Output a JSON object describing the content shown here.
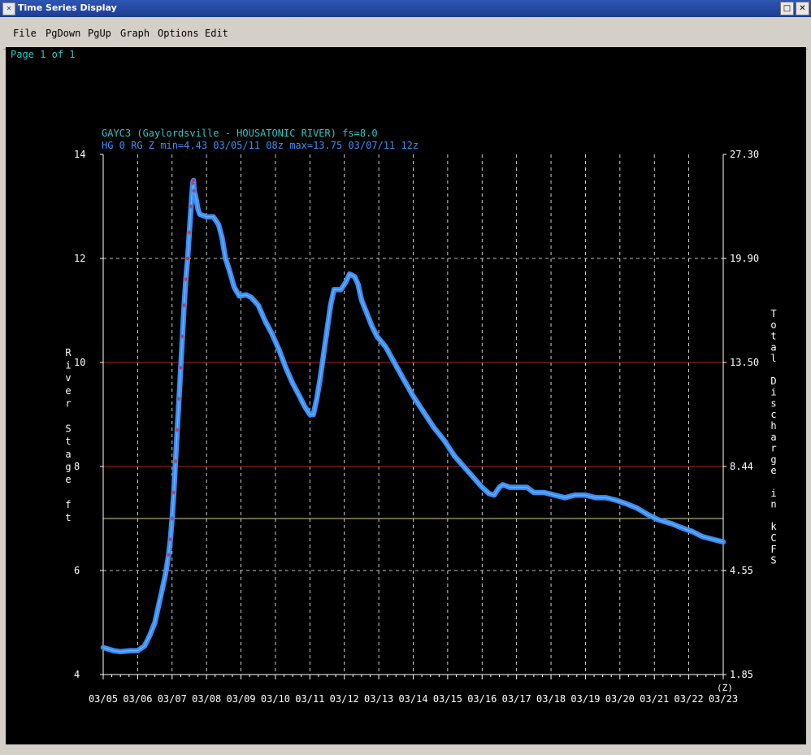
{
  "window": {
    "title": "Time Series Display"
  },
  "menu": [
    "File",
    "PgDown",
    "PgUp",
    "Graph",
    "Options",
    "Edit"
  ],
  "page_label": "Page 1 of 1",
  "header": {
    "line1": "GAYC3 (Gaylordsville - HOUSATONIC RIVER) fs=8.0",
    "line2": "HG 0 RG Z min=4.43 03/05/11 08z max=13.75 03/07/11 12z"
  },
  "colors": {
    "trace": "#3b8ff5",
    "observed": "#d6304b",
    "minor_flood": "#b42020",
    "action": "#d8d870",
    "text": "#2ec6c6",
    "axis": "#ffffff"
  },
  "chart_data": {
    "type": "line",
    "title": "GAYC3 (Gaylordsville - HOUSATONIC RIVER) fs=8.0",
    "ylabel": "River Stage ft",
    "y2label": "Total Discharge in kCFS",
    "xunit": "(Z)",
    "ylim": [
      4,
      14
    ],
    "yticks": [
      "14",
      "12",
      "10",
      "8",
      "6",
      "4"
    ],
    "y2ticks": [
      "27.30",
      "19.90",
      "13.50",
      "8.44",
      "4.55",
      "1.85"
    ],
    "xlim": [
      0,
      18
    ],
    "xticks": [
      "03/05",
      "03/06",
      "03/07",
      "03/08",
      "03/09",
      "03/10",
      "03/11",
      "03/12",
      "03/13",
      "03/14",
      "03/15",
      "03/16",
      "03/17",
      "03/18",
      "03/19",
      "03/20",
      "03/21",
      "03/22",
      "03/23"
    ],
    "threshold_lines": [
      {
        "y": 10,
        "color": "#b42020"
      },
      {
        "y": 8,
        "color": "#b42020"
      },
      {
        "y": 7,
        "color": "#d8d870"
      }
    ],
    "series": [
      {
        "points": [
          [
            0.0,
            4.52
          ],
          [
            0.3,
            4.46
          ],
          [
            0.5,
            4.44
          ],
          [
            0.8,
            4.46
          ],
          [
            1.0,
            4.46
          ],
          [
            1.2,
            4.55
          ],
          [
            1.35,
            4.75
          ],
          [
            1.5,
            5.0
          ],
          [
            1.6,
            5.3
          ],
          [
            1.7,
            5.6
          ],
          [
            1.8,
            5.9
          ],
          [
            1.9,
            6.3
          ],
          [
            1.95,
            6.6
          ],
          [
            2.0,
            7.0
          ],
          [
            2.05,
            7.5
          ],
          [
            2.1,
            8.1
          ],
          [
            2.15,
            8.7
          ],
          [
            2.2,
            9.3
          ],
          [
            2.25,
            9.9
          ],
          [
            2.3,
            10.5
          ],
          [
            2.35,
            11.1
          ],
          [
            2.4,
            11.6
          ],
          [
            2.45,
            12.0
          ],
          [
            2.5,
            12.5
          ],
          [
            2.55,
            13.0
          ],
          [
            2.6,
            13.45
          ],
          [
            2.62,
            13.5
          ],
          [
            2.64,
            13.3
          ],
          [
            2.68,
            13.2
          ],
          [
            2.75,
            12.95
          ],
          [
            2.8,
            12.85
          ],
          [
            3.0,
            12.8
          ],
          [
            3.2,
            12.8
          ],
          [
            3.35,
            12.65
          ],
          [
            3.45,
            12.4
          ],
          [
            3.55,
            12.0
          ],
          [
            3.65,
            11.8
          ],
          [
            3.8,
            11.45
          ],
          [
            3.95,
            11.28
          ],
          [
            4.15,
            11.3
          ],
          [
            4.3,
            11.25
          ],
          [
            4.5,
            11.1
          ],
          [
            4.7,
            10.8
          ],
          [
            4.9,
            10.55
          ],
          [
            5.1,
            10.25
          ],
          [
            5.3,
            9.9
          ],
          [
            5.5,
            9.6
          ],
          [
            5.7,
            9.35
          ],
          [
            5.85,
            9.15
          ],
          [
            6.0,
            9.0
          ],
          [
            6.1,
            9.0
          ],
          [
            6.2,
            9.3
          ],
          [
            6.3,
            9.7
          ],
          [
            6.45,
            10.4
          ],
          [
            6.6,
            11.1
          ],
          [
            6.7,
            11.4
          ],
          [
            6.9,
            11.4
          ],
          [
            7.05,
            11.55
          ],
          [
            7.15,
            11.7
          ],
          [
            7.3,
            11.65
          ],
          [
            7.4,
            11.5
          ],
          [
            7.5,
            11.2
          ],
          [
            7.65,
            10.95
          ],
          [
            7.8,
            10.7
          ],
          [
            7.95,
            10.5
          ],
          [
            8.2,
            10.3
          ],
          [
            8.45,
            10.0
          ],
          [
            8.7,
            9.7
          ],
          [
            9.0,
            9.35
          ],
          [
            9.3,
            9.05
          ],
          [
            9.6,
            8.75
          ],
          [
            9.9,
            8.5
          ],
          [
            10.0,
            8.4
          ],
          [
            10.2,
            8.2
          ],
          [
            10.4,
            8.05
          ],
          [
            10.6,
            7.9
          ],
          [
            10.8,
            7.75
          ],
          [
            11.0,
            7.6
          ],
          [
            11.2,
            7.48
          ],
          [
            11.35,
            7.45
          ],
          [
            11.5,
            7.6
          ],
          [
            11.6,
            7.65
          ],
          [
            11.8,
            7.6
          ],
          [
            12.0,
            7.6
          ],
          [
            12.3,
            7.6
          ],
          [
            12.5,
            7.5
          ],
          [
            12.8,
            7.5
          ],
          [
            13.1,
            7.45
          ],
          [
            13.4,
            7.4
          ],
          [
            13.7,
            7.45
          ],
          [
            14.0,
            7.45
          ],
          [
            14.3,
            7.4
          ],
          [
            14.6,
            7.4
          ],
          [
            14.9,
            7.35
          ],
          [
            15.2,
            7.28
          ],
          [
            15.5,
            7.2
          ],
          [
            15.8,
            7.08
          ],
          [
            16.1,
            6.98
          ],
          [
            16.5,
            6.9
          ],
          [
            16.8,
            6.82
          ],
          [
            17.1,
            6.75
          ],
          [
            17.4,
            6.65
          ],
          [
            17.7,
            6.6
          ],
          [
            18.0,
            6.55
          ]
        ]
      }
    ]
  }
}
